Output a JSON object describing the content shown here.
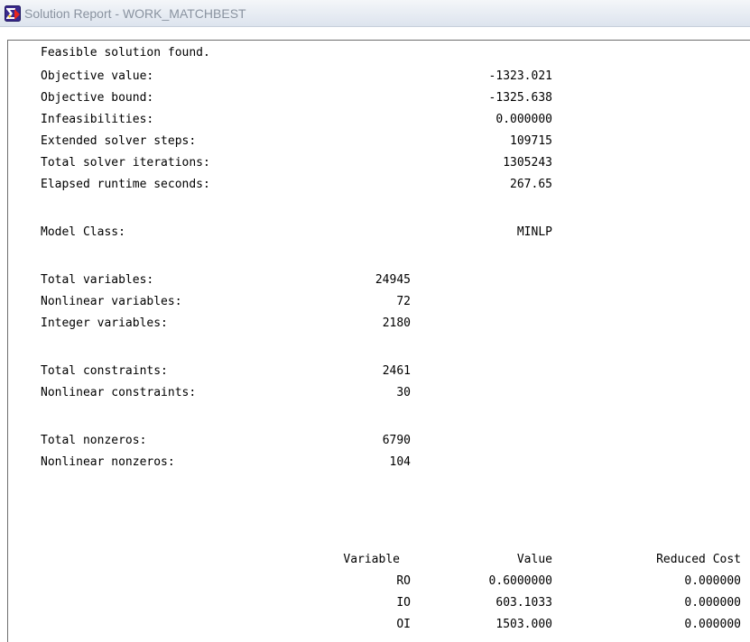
{
  "window": {
    "title": "Solution Report - WORK_MATCHBEST",
    "icon": "lingo-sigma-icon"
  },
  "report": {
    "status": "Feasible solution found.",
    "summary": [
      {
        "label": "Objective value:",
        "value": "-1323.021"
      },
      {
        "label": "Objective bound:",
        "value": "-1325.638"
      },
      {
        "label": "Infeasibilities:",
        "value": "0.000000"
      },
      {
        "label": "Extended solver steps:",
        "value": "109715"
      },
      {
        "label": "Total solver iterations:",
        "value": "1305243"
      },
      {
        "label": "Elapsed runtime seconds:",
        "value": "267.65"
      }
    ],
    "model_class": {
      "label": "Model Class:",
      "value": "MINLP"
    },
    "variables": [
      {
        "label": "Total variables:",
        "value": "24945"
      },
      {
        "label": "Nonlinear variables:",
        "value": "72"
      },
      {
        "label": "Integer variables:",
        "value": "2180"
      }
    ],
    "constraints": [
      {
        "label": "Total constraints:",
        "value": "2461"
      },
      {
        "label": "Nonlinear constraints:",
        "value": "30"
      }
    ],
    "nonzeros": [
      {
        "label": "Total nonzeros:",
        "value": "6790"
      },
      {
        "label": "Nonlinear nonzeros:",
        "value": "104"
      }
    ],
    "table": {
      "headers": {
        "variable": "Variable",
        "value": "Value",
        "reduced_cost": "Reduced Cost"
      },
      "rows": [
        {
          "variable": "RO",
          "value": "0.6000000",
          "reduced_cost": "0.000000"
        },
        {
          "variable": "IO",
          "value": "603.1033",
          "reduced_cost": "0.000000"
        },
        {
          "variable": "OI",
          "value": "1503.000",
          "reduced_cost": "0.000000"
        }
      ]
    }
  }
}
